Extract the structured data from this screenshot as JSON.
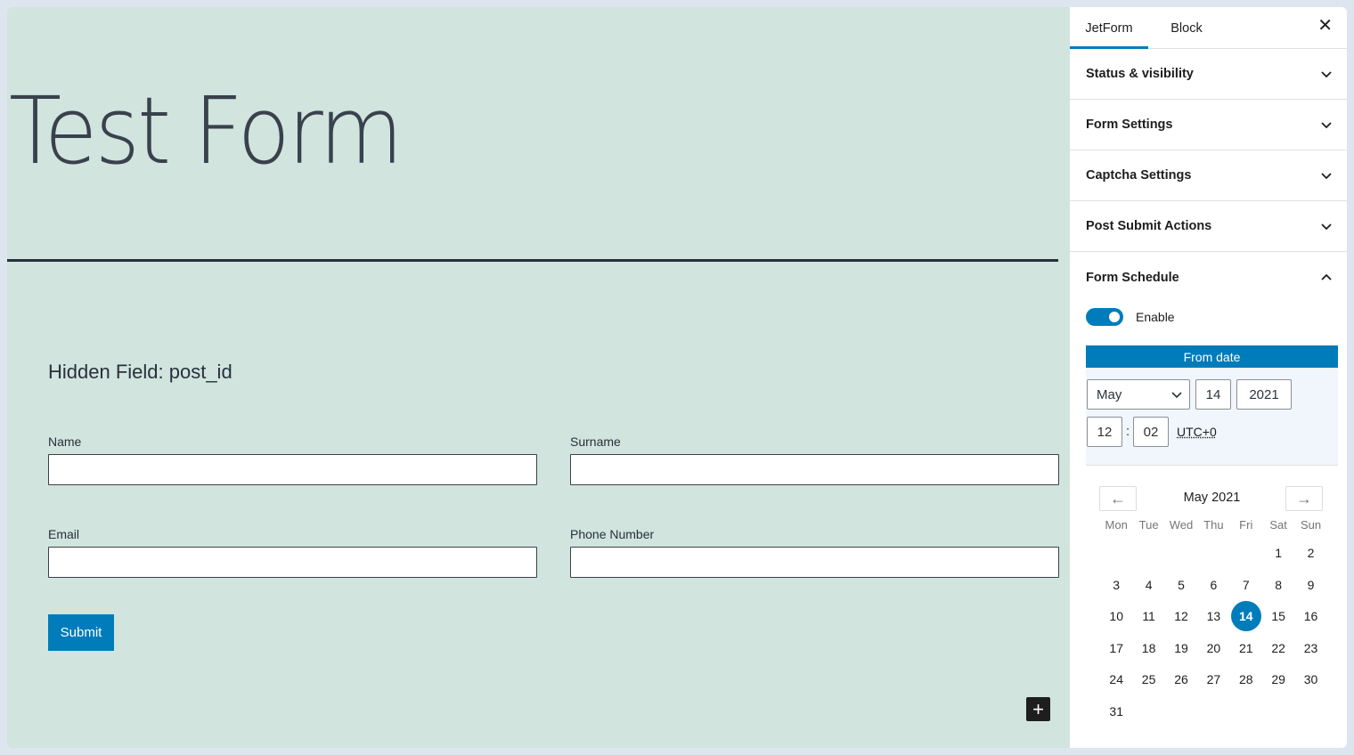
{
  "canvas": {
    "page_title": "Test Form",
    "hidden_field": "Hidden Field: post_id",
    "fields": {
      "name_label": "Name",
      "surname_label": "Surname",
      "email_label": "Email",
      "phone_label": "Phone Number"
    },
    "submit_label": "Submit",
    "add_block_glyph": "+"
  },
  "sidebar": {
    "tabs": [
      "JetForm",
      "Block"
    ],
    "close_glyph": "✕",
    "panels": [
      "Status & visibility",
      "Form Settings",
      "Captcha Settings",
      "Post Submit Actions"
    ],
    "schedule": {
      "title": "Form Schedule",
      "enable_label": "Enable",
      "enabled": true,
      "from_date_label": "From date",
      "month_value": "May",
      "day_value": "14",
      "year_value": "2021",
      "hour_value": "12",
      "minute_value": "02",
      "time_separator": ":",
      "timezone": "UTC+0"
    },
    "calendar": {
      "month_label": "May 2021",
      "prev_glyph": "←",
      "next_glyph": "→",
      "weekdays": [
        "Mon",
        "Tue",
        "Wed",
        "Thu",
        "Fri",
        "Sat",
        "Sun"
      ],
      "weeks": [
        [
          "",
          "",
          "",
          "",
          "",
          "1",
          "2"
        ],
        [
          "3",
          "4",
          "5",
          "6",
          "7",
          "8",
          "9"
        ],
        [
          "10",
          "11",
          "12",
          "13",
          "14",
          "15",
          "16"
        ],
        [
          "17",
          "18",
          "19",
          "20",
          "21",
          "22",
          "23"
        ],
        [
          "24",
          "25",
          "26",
          "27",
          "28",
          "29",
          "30"
        ],
        [
          "31",
          "",
          "",
          "",
          "",
          "",
          ""
        ]
      ],
      "selected_day": "14"
    }
  },
  "colors": {
    "accent": "#007cba",
    "canvas_bg": "#d1e4dd",
    "text_dark": "#28303d"
  }
}
